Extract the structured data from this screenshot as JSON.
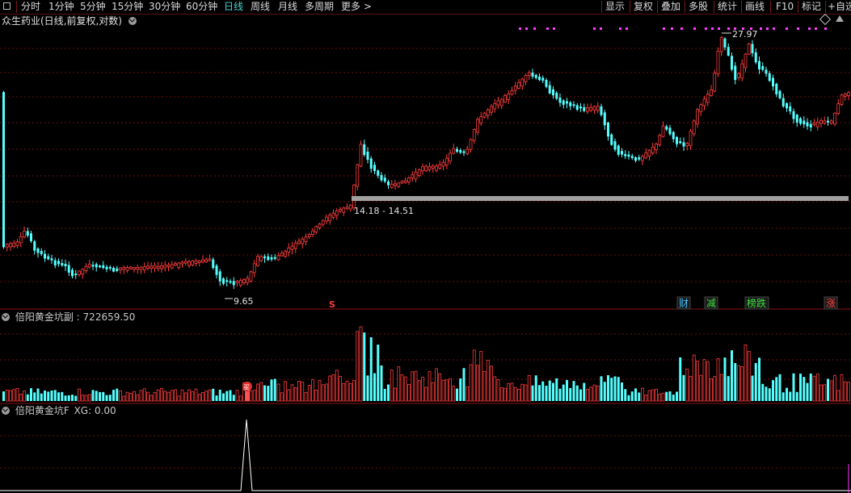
{
  "toolbar": {
    "periods": [
      "分时",
      "1分钟",
      "5分钟",
      "15分钟",
      "30分钟",
      "60分钟",
      "日线",
      "周线",
      "月线",
      "多周期",
      "更多 >"
    ],
    "active_period": "日线",
    "right_buttons": [
      "显示",
      "复权",
      "叠加",
      "多股",
      "统计",
      "画线",
      "F10",
      "标记",
      "+自选"
    ]
  },
  "main_pane": {
    "title": "众生药业(日线,前复权,对数)",
    "high_label": "27.97",
    "low_label": "9.65",
    "range_label": "14.18 - 14.51",
    "markers": [
      {
        "text": "财",
        "color": "#3ec0ff"
      },
      {
        "text": "减",
        "color": "#40e040"
      },
      {
        "text": "榜跌",
        "color": "#40e040"
      },
      {
        "text": "涨",
        "color": "#ff4040"
      }
    ],
    "s_marker": "S"
  },
  "vol_pane": {
    "title": "倍阳黄金坑副",
    "value": "722659.50",
    "badge": "买"
  },
  "ind_pane": {
    "title": "倍阳黄金坑F",
    "value_label": "XG: 0.00"
  },
  "colors": {
    "up": "#ff3c3c",
    "down": "#54ffff",
    "grid": "#6a1010",
    "support": "#a0a0a0",
    "dots": "#ff3cff"
  }
}
